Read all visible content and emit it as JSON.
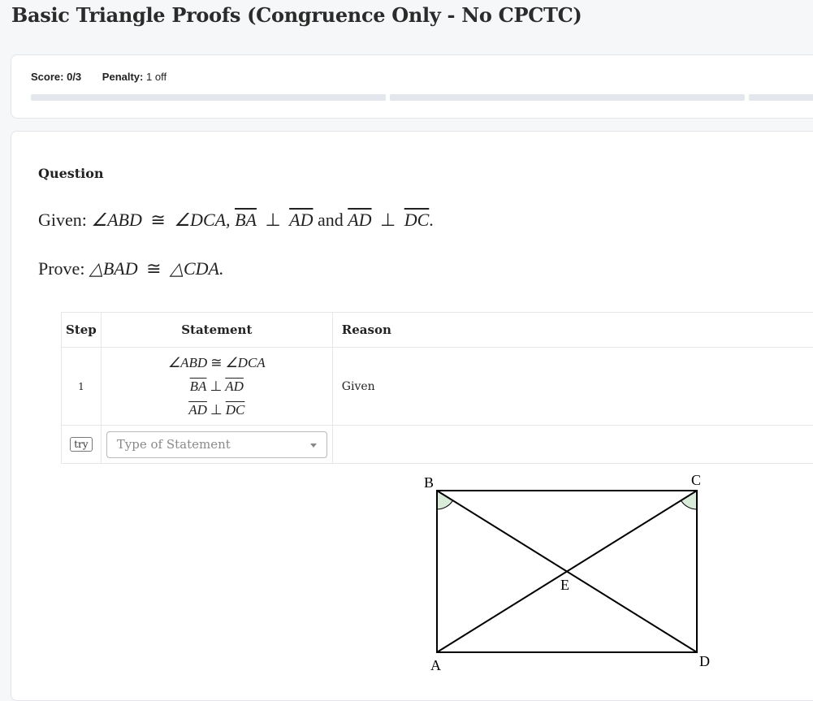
{
  "page": {
    "title": "Basic Triangle Proofs (Congruence Only - No CPCTC)"
  },
  "score": {
    "score_label": "Score:",
    "score_value": "0/3",
    "penalty_label": "Penalty:",
    "penalty_value": "1 off",
    "segments": 3
  },
  "question": {
    "heading": "Question",
    "given_label": "Given:",
    "given": {
      "angle1": "∠ABD",
      "cong": "≅",
      "angle2": "∠DCA,",
      "seg1": "BA",
      "perp": "⊥",
      "seg2": "AD",
      "and": "and",
      "seg3": "AD",
      "seg4": "DC",
      "end": "."
    },
    "prove_label": "Prove:",
    "prove": {
      "tri1": "△BAD",
      "cong": "≅",
      "tri2": "△CDA."
    }
  },
  "table": {
    "headers": {
      "step": "Step",
      "statement": "Statement",
      "reason": "Reason"
    },
    "rows": [
      {
        "step": "1",
        "statement": {
          "line1": {
            "left": "∠ABD",
            "op": "≅",
            "right": "∠DCA"
          },
          "line2": {
            "left": "BA",
            "op": "⊥",
            "right": "AD"
          },
          "line3": {
            "left": "AD",
            "op": "⊥",
            "right": "DC"
          }
        },
        "reason": "Given"
      }
    ],
    "input_row": {
      "try_label": "try",
      "select_placeholder": "Type of Statement"
    }
  },
  "diagram": {
    "labels": {
      "B": "B",
      "C": "C",
      "E": "E",
      "A": "A",
      "D": "D"
    },
    "angle_mark_color": "#d9ecd9"
  }
}
